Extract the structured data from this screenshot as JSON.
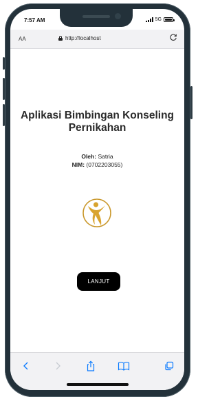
{
  "status_bar": {
    "time": "7:57 AM",
    "network": "5G"
  },
  "address_bar": {
    "text_size_label": "AA",
    "url": "http://localhost",
    "lock_icon": "lock-icon",
    "reload_icon": "reload-icon"
  },
  "page": {
    "title": "Aplikasi Bimbingan Konseling Pernikahan",
    "author_label": "Oleh:",
    "author_name": "Satria",
    "nim_label": "NIM:",
    "nim_value": "(0702203055)",
    "logo_icon": "person-figure-logo",
    "continue_button": "LANJUT"
  },
  "toolbar": {
    "icons": [
      "back-icon",
      "forward-icon",
      "share-icon",
      "bookmarks-icon",
      "tabs-icon"
    ]
  },
  "colors": {
    "phone_frame": "#23313a",
    "browser_chrome": "#f2f2f4",
    "ios_blue": "#0a7aff",
    "logo_gold": "#c9972a",
    "button_bg": "#000000"
  }
}
